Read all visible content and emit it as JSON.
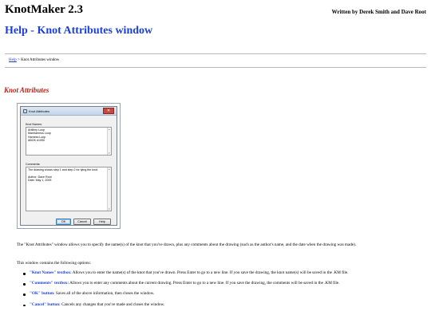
{
  "header": {
    "app_title": "KnotMaker 2.3",
    "authors": "Written by Derek Smith and Dave Root",
    "page_title": "Help - Knot Attributes window"
  },
  "breadcrumb": {
    "link": "Help",
    "separator": " > ",
    "current": "Knot Attributes window"
  },
  "section_title": "Knot Attributes",
  "dialog": {
    "title": "Knot Attributes",
    "close": "✕",
    "knot_names_label": "Knot Names:",
    "knot_names": [
      "Artillery Loop",
      "Manharness Loop",
      "Harness Loop",
      "ABOK #1050"
    ],
    "comments_label": "Comments:",
    "comments": [
      "The drawing shows step 1 and step 2 for tying the knot.",
      "",
      "Author: Dave Root",
      "Date:  May 1, 2009"
    ],
    "ok_label": "OK",
    "cancel_label": "Cancel",
    "help_label": "Help"
  },
  "content": {
    "intro": "The \"Knot Attributes\" window allows you to specify the name(s) of the knot that you've drawn, plus any comments about the drawing (such as the author's name, and the date when the drawing was made).",
    "options_intro": "This window contains the following options:",
    "options": [
      {
        "label": "\"Knot Names\" textbox:",
        "text": " Allows you to enter the name(s) of the knot that you've drawn. Press Enter to go to a new line. If you save the drawing, the knot name(s) will be saved in the .KM file."
      },
      {
        "label": "\"Comments\" textbox:",
        "text": " Allows you to enter any comments about the current drawing. Press Enter to go to a new line. If you save the drawing, the comments will be saved in the .KM file."
      },
      {
        "label": "\"OK\" button:",
        "text": " Saves all of the above information, then closes the window."
      },
      {
        "label": "\"Cancel\" button:",
        "text": " Cancels any changes that you've made and closes the window."
      }
    ]
  }
}
